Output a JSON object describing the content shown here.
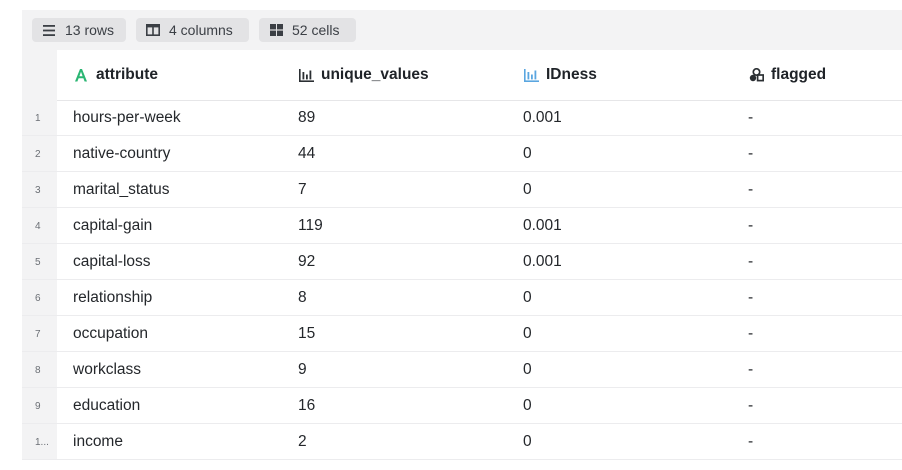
{
  "toolbar": {
    "rows_label": "13 rows",
    "columns_label": "4 columns",
    "cells_label": "52 cells"
  },
  "columns": [
    {
      "label": "attribute",
      "icon": "text-type-icon"
    },
    {
      "label": "unique_values",
      "icon": "bar-chart-icon"
    },
    {
      "label": "IDness",
      "icon": "bar-chart-icon"
    },
    {
      "label": "flagged",
      "icon": "boolean-shapes-icon"
    }
  ],
  "rows": [
    {
      "num": "1",
      "cells": [
        "hours-per-week",
        "89",
        "0.001",
        "-"
      ]
    },
    {
      "num": "2",
      "cells": [
        "native-country",
        "44",
        "0",
        "-"
      ]
    },
    {
      "num": "3",
      "cells": [
        "marital_status",
        "7",
        "0",
        "-"
      ]
    },
    {
      "num": "4",
      "cells": [
        "capital-gain",
        "119",
        "0.001",
        "-"
      ]
    },
    {
      "num": "5",
      "cells": [
        "capital-loss",
        "92",
        "0.001",
        "-"
      ]
    },
    {
      "num": "6",
      "cells": [
        "relationship",
        "8",
        "0",
        "-"
      ]
    },
    {
      "num": "7",
      "cells": [
        "occupation",
        "15",
        "0",
        "-"
      ]
    },
    {
      "num": "8",
      "cells": [
        "workclass",
        "9",
        "0",
        "-"
      ]
    },
    {
      "num": "9",
      "cells": [
        "education",
        "16",
        "0",
        "-"
      ]
    },
    {
      "num": "1...",
      "cells": [
        "income",
        "2",
        "0",
        "-"
      ]
    }
  ],
  "colors": {
    "text_icon": "#2bb673",
    "idness_icon": "#5aa6e0",
    "dark_icon": "#2b2f33"
  }
}
